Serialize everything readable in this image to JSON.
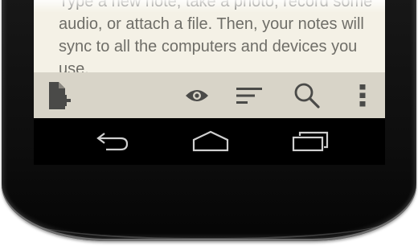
{
  "note": {
    "lines": [
      "Type a new note, take a photo, record some",
      "audio, or attach a file. Then, your notes will",
      "sync to all the computers and devices you",
      "use."
    ]
  },
  "action_bar": {
    "background": "#d8d4c8",
    "icon_color": "#4a4a48",
    "icons": [
      "new-note-icon",
      "preview-eye-icon",
      "sort-icon",
      "search-icon",
      "overflow-menu-icon"
    ]
  },
  "nav_bar": {
    "icons": [
      "back-icon",
      "home-icon",
      "recent-apps-icon"
    ],
    "icon_color": "#cfcfcf"
  },
  "colors": {
    "note_background": "#f4f1e6",
    "note_text": "#6f6e68",
    "phone_body": "#111111"
  }
}
